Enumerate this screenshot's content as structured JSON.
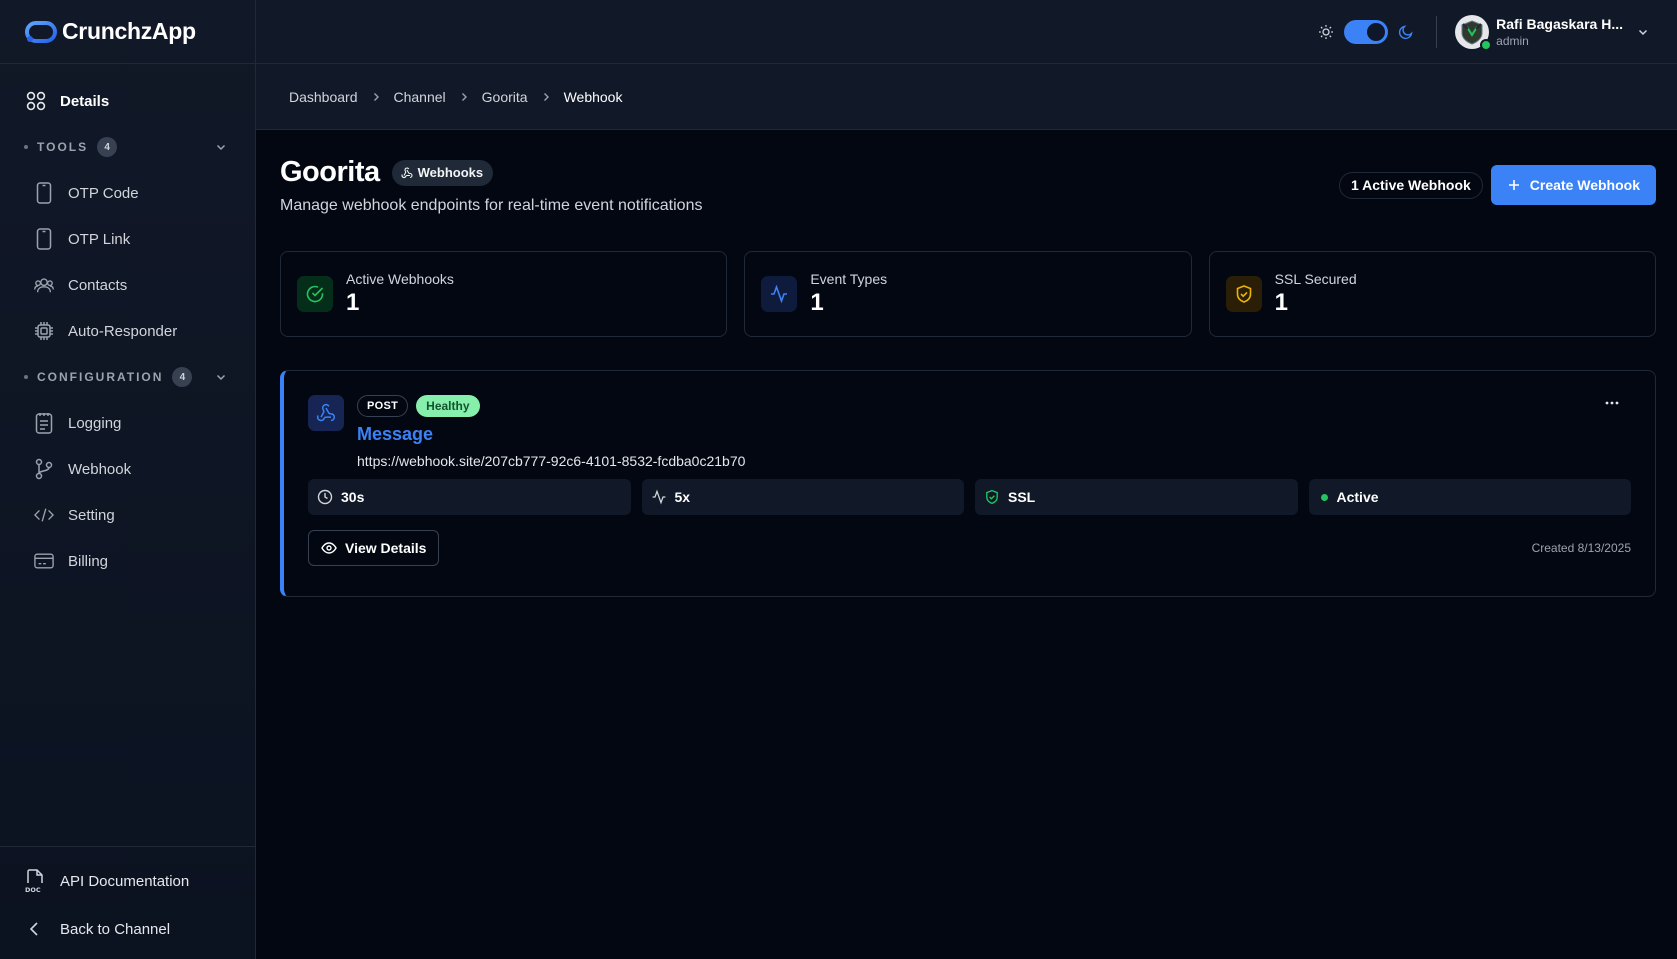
{
  "app": {
    "name": "CrunchzApp"
  },
  "sidebar": {
    "top_item": {
      "label": "Details",
      "icon": "grid-icon"
    },
    "sections": [
      {
        "title": "TOOLS",
        "count": "4",
        "items": [
          {
            "label": "OTP Code",
            "icon": "phone-icon"
          },
          {
            "label": "OTP Link",
            "icon": "phone-icon"
          },
          {
            "label": "Contacts",
            "icon": "users-icon"
          },
          {
            "label": "Auto-Responder",
            "icon": "cpu-icon"
          }
        ]
      },
      {
        "title": "CONFIGURATION",
        "count": "4",
        "items": [
          {
            "label": "Logging",
            "icon": "log-file-icon"
          },
          {
            "label": "Webhook",
            "icon": "git-branch-icon"
          },
          {
            "label": "Setting",
            "icon": "code-icon"
          },
          {
            "label": "Billing",
            "icon": "credit-card-icon"
          }
        ]
      }
    ],
    "footer": [
      {
        "label": "API Documentation",
        "icon": "doc-file-icon"
      },
      {
        "label": "Back to Channel",
        "icon": "chevron-left-icon"
      }
    ]
  },
  "topbar": {
    "theme": "dark",
    "user": {
      "name": "Rafi Bagaskara H...",
      "role": "admin",
      "status": "online"
    }
  },
  "breadcrumb": [
    "Dashboard",
    "Channel",
    "Goorita",
    "Webhook"
  ],
  "page": {
    "title": "Goorita",
    "badge": "Webhooks",
    "subtitle": "Manage webhook endpoints for real-time event notifications",
    "active_count_label": "1 Active Webhook",
    "create_button": "Create Webhook"
  },
  "stats": [
    {
      "label": "Active Webhooks",
      "value": "1",
      "icon": "check-circle-icon",
      "color": "#22c55e"
    },
    {
      "label": "Event Types",
      "value": "1",
      "icon": "activity-icon",
      "color": "#3b82f6"
    },
    {
      "label": "SSL Secured",
      "value": "1",
      "icon": "shield-check-icon",
      "color": "#eab308"
    }
  ],
  "webhook": {
    "method": "POST",
    "health": "Healthy",
    "name": "Message",
    "url": "https://webhook.site/207cb777-92c6-4101-8532-fcdba0c21b70",
    "timeout": "30s",
    "retries": "5x",
    "ssl": "SSL",
    "status": "Active",
    "view_button": "View Details",
    "created": "Created 8/13/2025"
  },
  "colors": {
    "accent": "#3b82f6",
    "background": "#030712",
    "sidebar": "#111827",
    "success": "#22c55e",
    "warning": "#eab308"
  }
}
